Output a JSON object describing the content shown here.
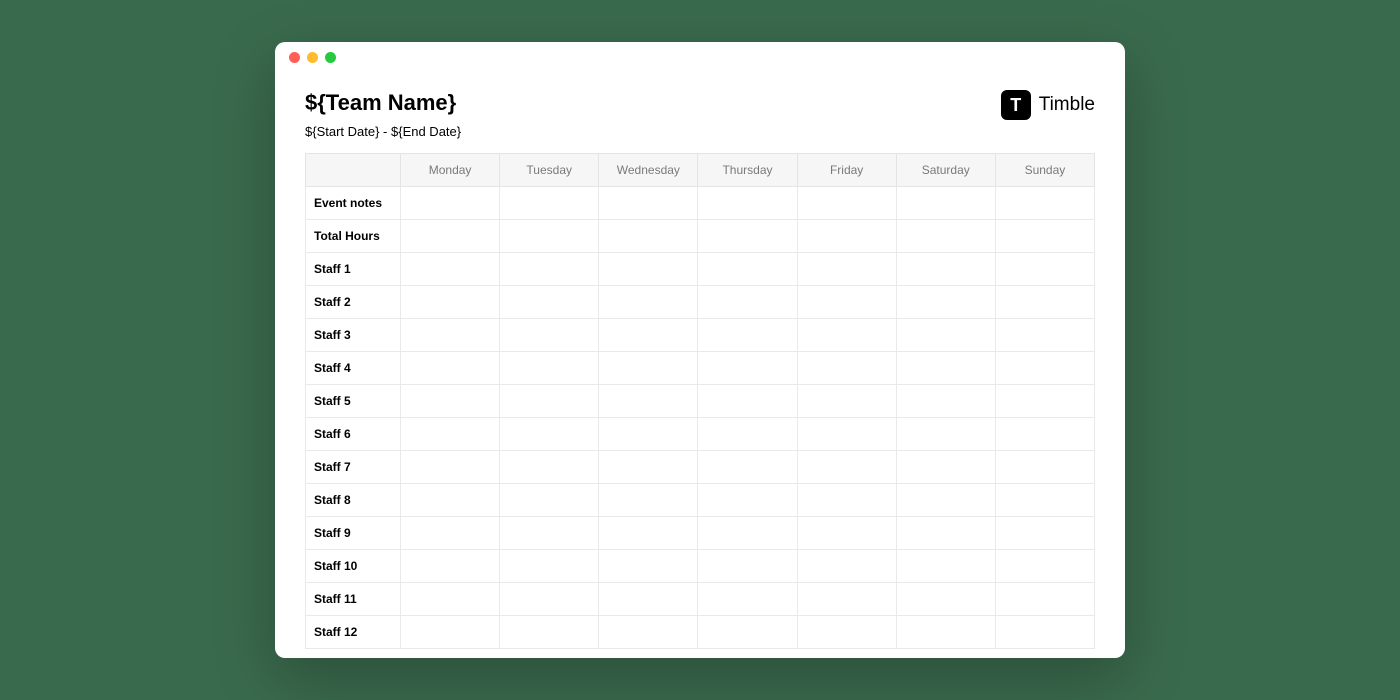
{
  "header": {
    "team_name": "${Team Name}",
    "date_range": "${Start Date} - ${End Date}"
  },
  "brand": {
    "logo_letter": "T",
    "name": "Timble"
  },
  "table": {
    "days": [
      "Monday",
      "Tuesday",
      "Wednesday",
      "Thursday",
      "Friday",
      "Saturday",
      "Sunday"
    ],
    "rows": [
      {
        "label": "Event notes"
      },
      {
        "label": "Total Hours"
      },
      {
        "label": "Staff 1"
      },
      {
        "label": "Staff 2"
      },
      {
        "label": "Staff 3"
      },
      {
        "label": "Staff 4"
      },
      {
        "label": "Staff 5"
      },
      {
        "label": "Staff 6"
      },
      {
        "label": "Staff 7"
      },
      {
        "label": "Staff 8"
      },
      {
        "label": "Staff 9"
      },
      {
        "label": "Staff 10"
      },
      {
        "label": "Staff 11"
      },
      {
        "label": "Staff 12"
      }
    ]
  }
}
